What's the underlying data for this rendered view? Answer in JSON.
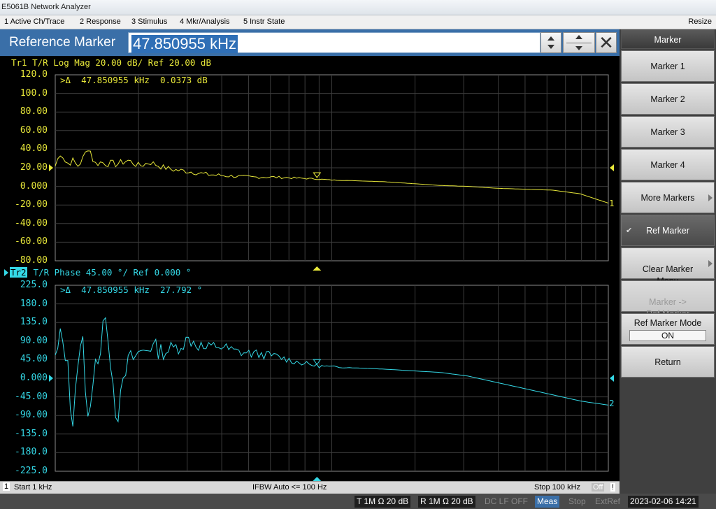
{
  "window": {
    "title": "E5061B Network Analyzer",
    "resize_label": "Resize"
  },
  "menu": [
    "1 Active Ch/Trace",
    "2 Response",
    "3 Stimulus",
    "4 Mkr/Analysis",
    "5 Instr State"
  ],
  "entry": {
    "label": "Reference Marker",
    "value": "47.850955 kHz",
    "close_glyph": "✕"
  },
  "trace1": {
    "header": "Tr1 T/R Log Mag 20.00 dB/ Ref 20.00 dB",
    "marker_readout": ">Δ  47.850955 kHz  0.0373 dB",
    "ticks": [
      "120.0",
      "100.0",
      "80.00",
      "60.00",
      "40.00",
      "20.00",
      "0.000",
      "-20.00",
      "-40.00",
      "-60.00",
      "-80.00"
    ],
    "ref_tick": "20.00",
    "color": "#e8e83a",
    "end_label": "1"
  },
  "trace2": {
    "id_label": "Tr2",
    "header": " T/R Phase 45.00 °/ Ref 0.000 °",
    "marker_readout": ">Δ  47.850955 kHz  27.792 °",
    "ticks": [
      "225.0",
      "180.0",
      "135.0",
      "90.00",
      "45.00",
      "0.000",
      "-45.00",
      "-90.00",
      "-135.0",
      "-180.0",
      "-225.0"
    ],
    "ref_tick": "0.000",
    "color": "#34d8e6",
    "end_label": "2"
  },
  "footer": {
    "channel": "1",
    "start": "Start 1 kHz",
    "ifbw": "IFBW Auto <= 100 Hz",
    "stop": "Stop 100 kHz",
    "off": "Off",
    "excl": "!"
  },
  "status": {
    "t_input": "T 1M Ω 20 dB",
    "r_input": "R 1M Ω 20 dB",
    "dc_lf": "DC LF OFF",
    "meas": "Meas",
    "stop": "Stop",
    "extref": "ExtRef",
    "datetime": "2023-02-06 14:21"
  },
  "softkeys": {
    "title": "Marker",
    "items": [
      {
        "label": "Marker 1"
      },
      {
        "label": "Marker 2"
      },
      {
        "label": "Marker 3"
      },
      {
        "label": "Marker 4"
      },
      {
        "label": "More Markers"
      },
      {
        "label": "Ref Marker"
      },
      {
        "label": "Clear Marker\nMenu"
      },
      {
        "label": "Marker ->\nRef Marker"
      },
      {
        "label": "Ref Marker Mode",
        "value": "ON"
      },
      {
        "label": "Return"
      }
    ]
  },
  "chart_data": [
    {
      "type": "line",
      "title": "Tr1 T/R Log Mag 20.00 dB/ Ref 20.00 dB",
      "xlim": [
        1,
        100
      ],
      "ylim": [
        -80,
        120
      ],
      "series": [
        {
          "name": "Tr1",
          "x": [
            1,
            2,
            3,
            4,
            5,
            6,
            7,
            8,
            9,
            10,
            12,
            14,
            16,
            18,
            20,
            22,
            25,
            28,
            30,
            33,
            36,
            40,
            44,
            47.85,
            50,
            55,
            60,
            65,
            70,
            75,
            80,
            85,
            90,
            95,
            100
          ],
          "values": [
            22,
            38,
            24,
            28,
            22,
            30,
            44,
            24,
            26,
            25,
            24,
            28,
            22,
            26,
            21,
            18,
            16,
            13,
            12,
            11,
            10,
            10,
            9,
            8,
            7,
            6,
            5,
            3,
            1,
            0,
            -2,
            -3,
            -4,
            -8,
            -18
          ]
        }
      ]
    },
    {
      "type": "line",
      "title": "Tr2 T/R Phase 45.00 °/ Ref 0.000 °",
      "xlim": [
        1,
        100
      ],
      "ylim": [
        -225,
        225
      ],
      "series": [
        {
          "name": "Tr2",
          "x": [
            1,
            2,
            3,
            4,
            5,
            6,
            7,
            8,
            9,
            10,
            12,
            14,
            16,
            18,
            20,
            22,
            25,
            28,
            30,
            33,
            36,
            40,
            44,
            47.85,
            50,
            55,
            60,
            65,
            70,
            75,
            80,
            85,
            90,
            95,
            100
          ],
          "values": [
            40,
            100,
            60,
            -110,
            40,
            80,
            -140,
            60,
            40,
            170,
            -100,
            40,
            60,
            80,
            65,
            70,
            95,
            70,
            80,
            65,
            60,
            55,
            40,
            30,
            28,
            25,
            22,
            18,
            14,
            5,
            -10,
            -25,
            -40,
            -55,
            -65
          ]
        }
      ]
    }
  ]
}
